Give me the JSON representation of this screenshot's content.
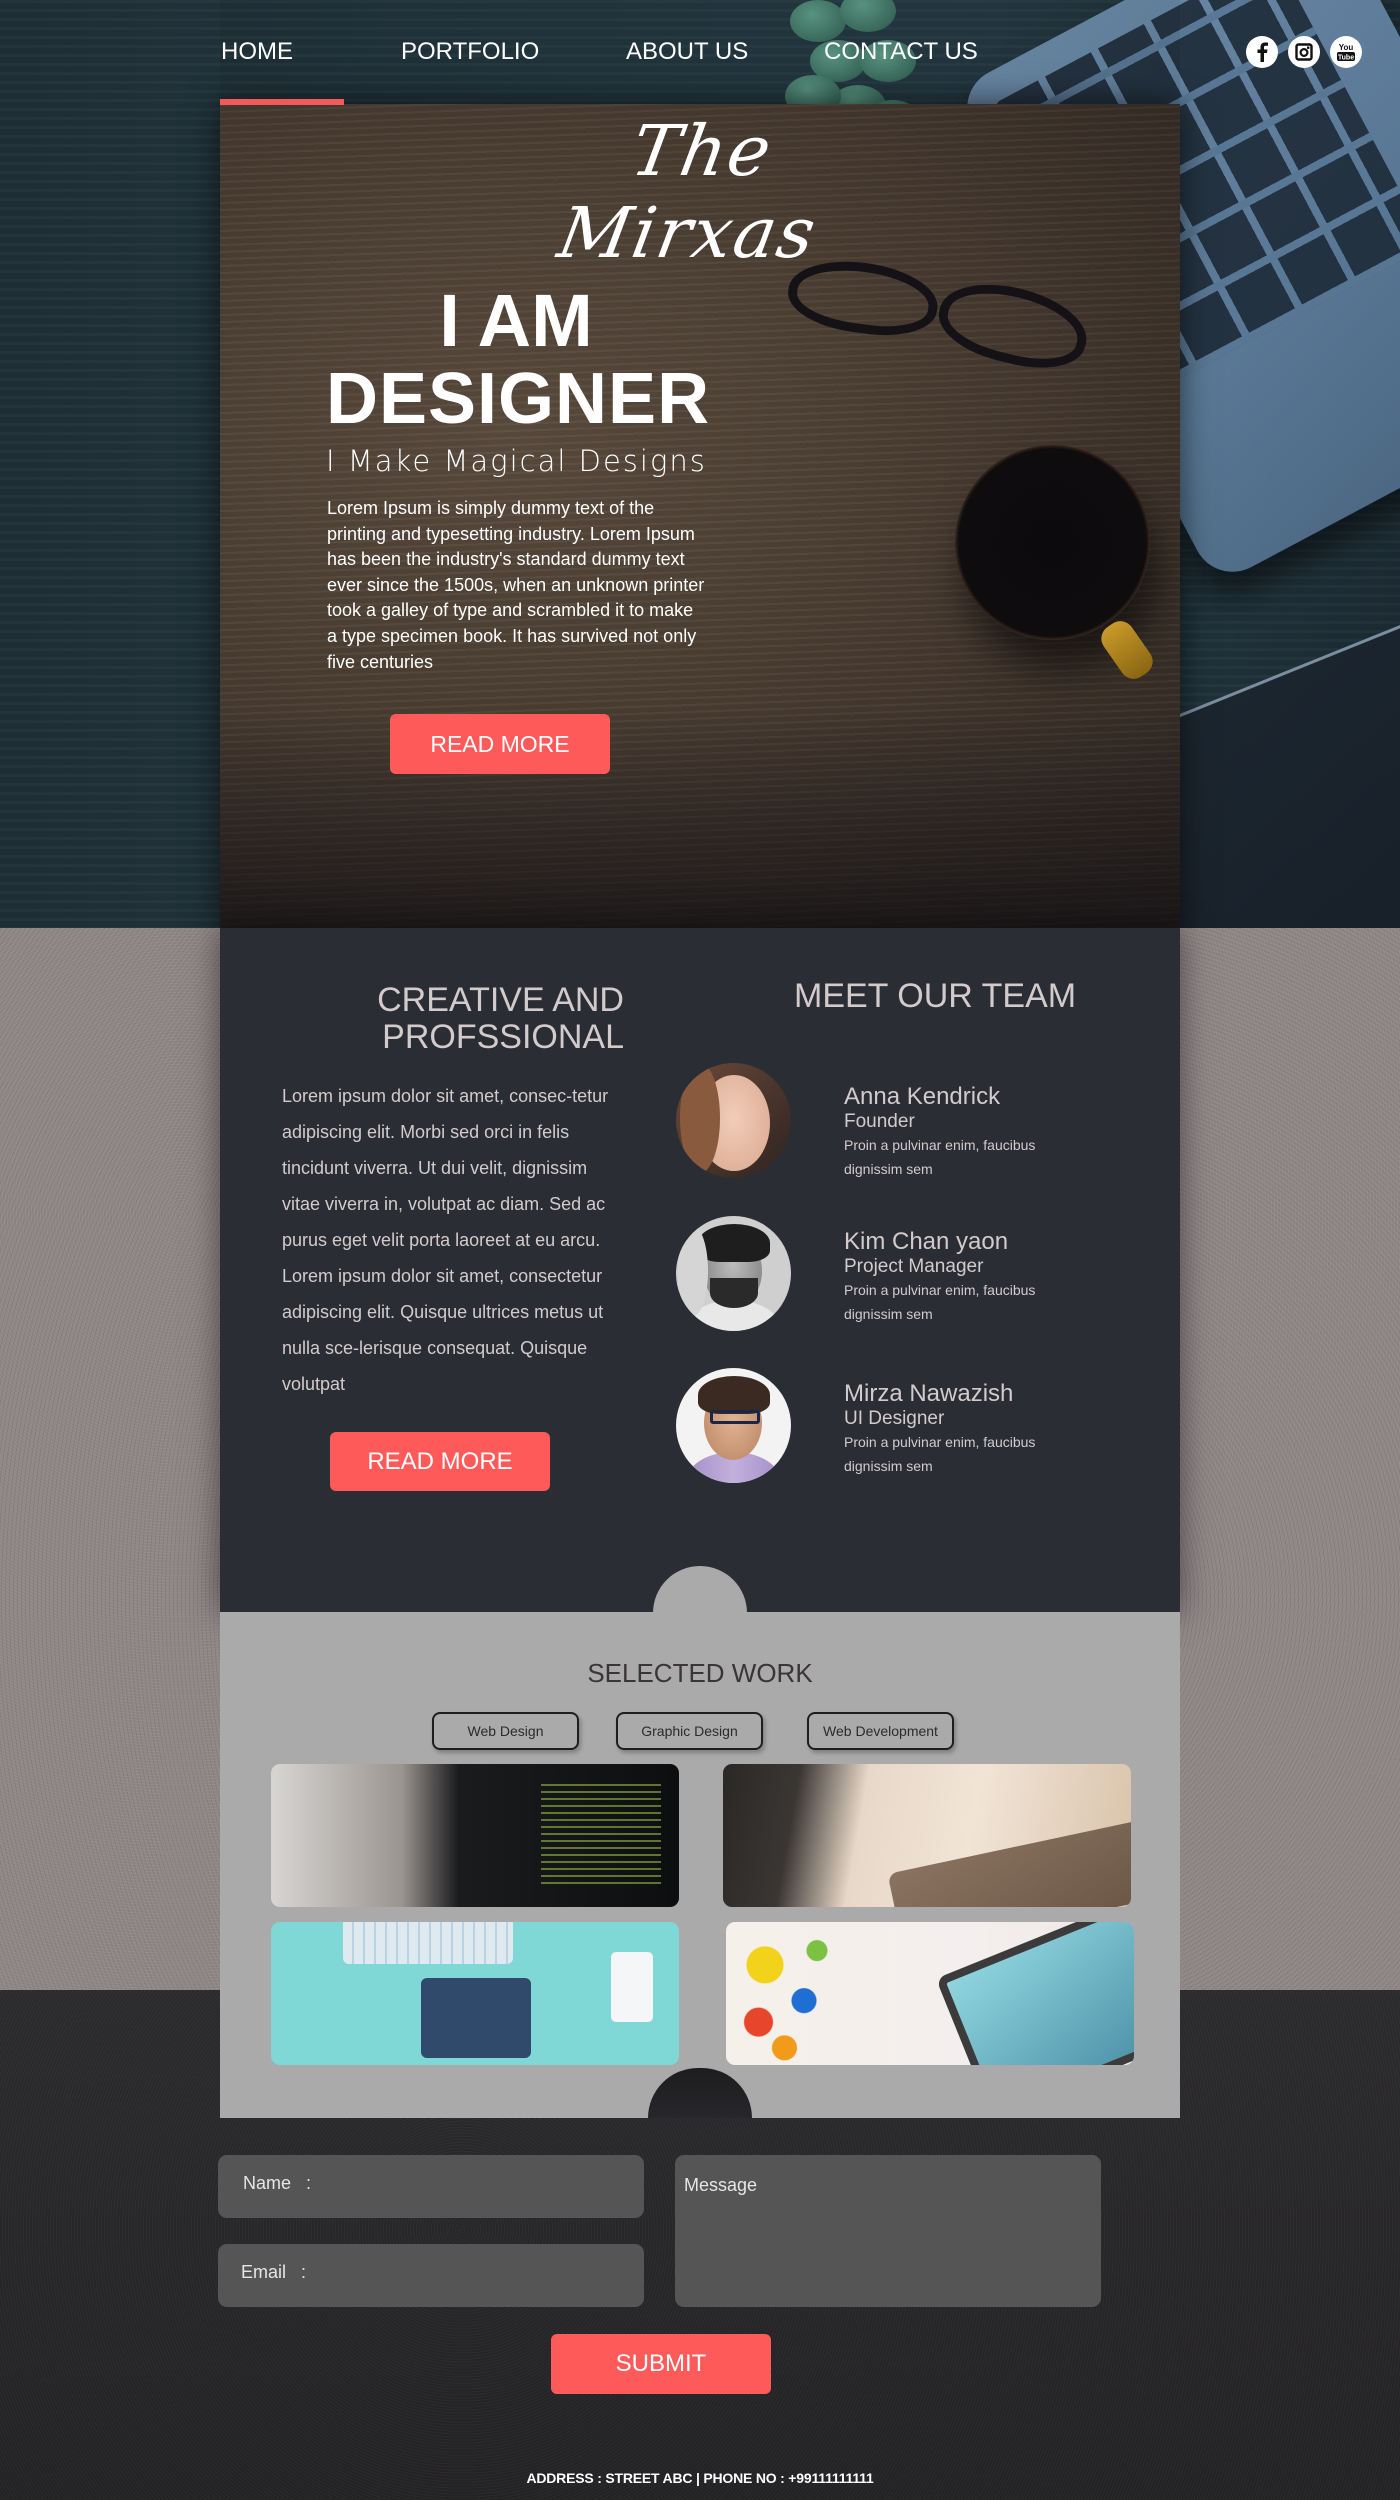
{
  "nav": {
    "items": [
      {
        "label": "HOME",
        "active": true
      },
      {
        "label": "PORTFOLIO",
        "active": false
      },
      {
        "label": "ABOUT US",
        "active": false
      },
      {
        "label": "CONTACT US",
        "active": false
      }
    ],
    "social": [
      {
        "name": "facebook",
        "glyph": "f"
      },
      {
        "name": "instagram",
        "glyph": "◎"
      },
      {
        "name": "youtube",
        "glyph": "You Tube"
      }
    ]
  },
  "brand": {
    "logo": "The Mirxas",
    "accent_color": "#ff5a5a"
  },
  "hero": {
    "title_line1": "I AM",
    "title_line2": "DESIGNER",
    "subtitle": "I Make Magical Designs",
    "body": "Lorem Ipsum is simply dummy text of the printing and typesetting industry. Lorem Ipsum has been the industry's standard dummy text ever since the 1500s, when an unknown printer took a galley of type and scrambled it to make a type specimen book. It has survived not only five centuries",
    "cta": "READ MORE"
  },
  "about": {
    "title_line1": "CREATIVE AND",
    "title_line2": "PROFSSIONAL",
    "body": "Lorem ipsum dolor sit amet, consec-tetur adipiscing elit. Morbi sed orci in felis tincidunt viverra. Ut dui velit, dignissim vitae viverra in, volutpat ac diam. Sed ac purus eget velit porta laoreet at eu arcu. Lorem ipsum dolor sit amet, consectetur adipiscing elit. Quisque ultrices metus ut nulla sce-lerisque consequat. Quisque volutpat",
    "cta": "READ MORE"
  },
  "team": {
    "title": "MEET OUR TEAM",
    "members": [
      {
        "name": "Anna Kendrick",
        "role": "Founder",
        "desc": "Proin a pulvinar enim, faucibus dignissim sem"
      },
      {
        "name": "Kim Chan yaon",
        "role": "Project Manager",
        "desc": "Proin a pulvinar enim, faucibus dignissim sem"
      },
      {
        "name": "Mirza Nawazish",
        "role": "UI Designer",
        "desc": "Proin a pulvinar enim, faucibus dignissim sem"
      }
    ]
  },
  "work": {
    "title": "SELECTED WORK",
    "filters": [
      "Web Design",
      "Graphic Design",
      "Web Development"
    ],
    "items": [
      {
        "alt": "code-on-laptop"
      },
      {
        "alt": "drawing-tablet-stylus"
      },
      {
        "alt": "flat-design-desk-illustration"
      },
      {
        "alt": "graphic-design-tablet-splash"
      }
    ]
  },
  "contact": {
    "name_label": "Name   :",
    "email_label": "Email   :",
    "message_label": "Message",
    "submit": "SUBMIT"
  },
  "footer": {
    "text": "ADDRESS : STREET ABC | PHONE NO : +99111111111"
  }
}
